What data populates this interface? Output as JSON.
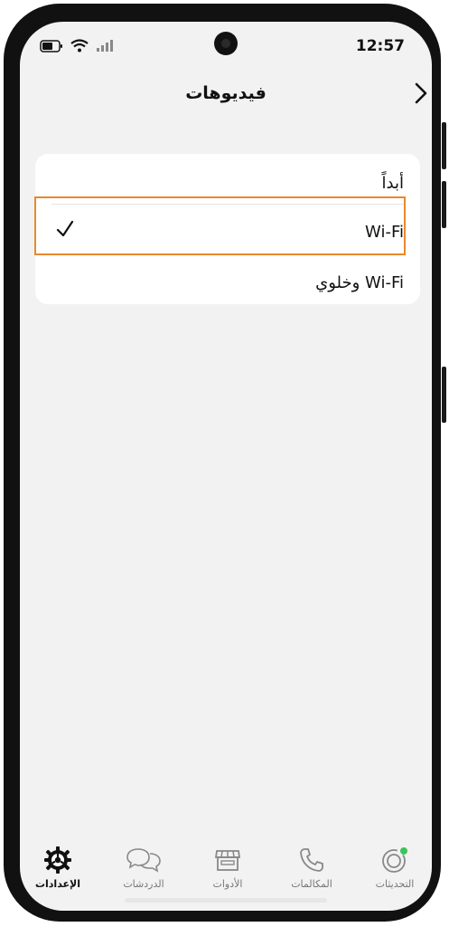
{
  "status_bar": {
    "time": "12:57"
  },
  "header": {
    "title": "فيديوهات"
  },
  "options": [
    {
      "label": "أبداً",
      "selected": false
    },
    {
      "label": "Wi-Fi",
      "selected": true
    },
    {
      "label": "Wi-Fi وخلوي",
      "selected": false
    }
  ],
  "tabs": [
    {
      "label": "الإعدادات",
      "icon": "settings-gear-icon",
      "active": true
    },
    {
      "label": "الدردشات",
      "icon": "chat-bubbles-icon",
      "active": false
    },
    {
      "label": "الأدوات",
      "icon": "store-icon",
      "active": false
    },
    {
      "label": "المكالمات",
      "icon": "phone-icon",
      "active": false
    },
    {
      "label": "التحديثات",
      "icon": "status-updates-icon",
      "active": false
    }
  ],
  "colors": {
    "highlight": "#e8892a",
    "status_dot": "#3cc45b"
  }
}
